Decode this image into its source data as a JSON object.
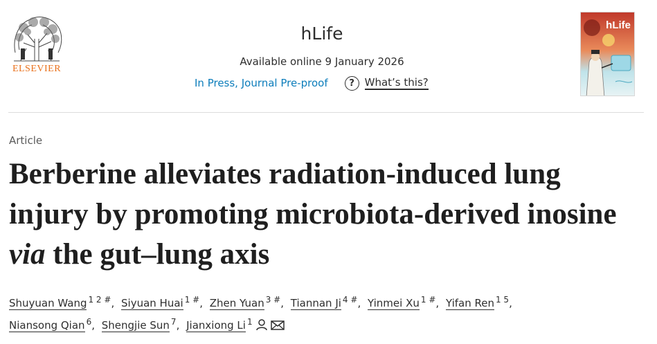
{
  "publisher": {
    "logo_text": "ELSEVIER",
    "icon": "elsevier-tree-logo"
  },
  "journal": {
    "title": "hLife",
    "availability": "Available online 9 January 2026",
    "status_link": "In Press, Journal Pre-proof",
    "whats_this": "What’s this?",
    "help_icon": "question-mark-icon",
    "cover_title": "hLife"
  },
  "article": {
    "type": "Article",
    "title_part1": "Berberine alleviates radiation-induced lung injury by promoting microbiota-derived inosine ",
    "title_italic": "via",
    "title_part2": " the gut–lung axis"
  },
  "authors": [
    {
      "name": "Shuyuan Wang",
      "sup": "1 2 #"
    },
    {
      "name": "Siyuan Huai",
      "sup": "1 #"
    },
    {
      "name": "Zhen Yuan",
      "sup": "3 #"
    },
    {
      "name": "Tiannan Ji",
      "sup": "4 #"
    },
    {
      "name": "Yinmei Xu",
      "sup": "1 #"
    },
    {
      "name": "Yifan Ren",
      "sup": "1 5"
    },
    {
      "name": "Niansong Qian",
      "sup": "6"
    },
    {
      "name": "Shengjie Sun",
      "sup": "7"
    },
    {
      "name": "Jianxiong Li",
      "sup": "1",
      "icons": [
        "person-icon",
        "envelope-icon"
      ]
    }
  ],
  "colors": {
    "link": "#0c7dbb",
    "elsevier_orange": "#e9711c",
    "text": "#1f1f1f"
  }
}
